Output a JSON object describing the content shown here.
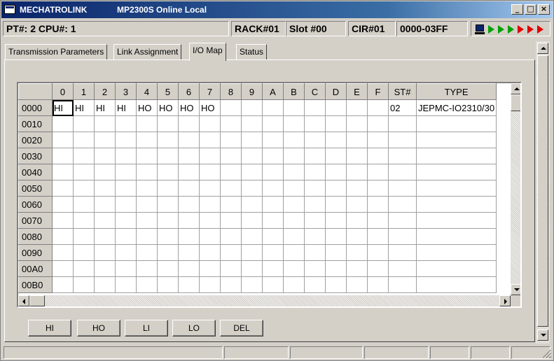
{
  "window": {
    "title_left": "MECHATROLINK",
    "title_right": "MP2300S  Online  Local",
    "controls": {
      "minimize": "_",
      "maximize": "□",
      "close": "×"
    }
  },
  "header": {
    "pt_cpu": "PT#: 2 CPU#: 1",
    "rack": "RACK#01",
    "slot": "Slot #00",
    "cir": "CIR#01",
    "range": "0000-03FF",
    "indicator": {
      "icon": "pc-icon",
      "arrows_green": 3,
      "arrows_red": 3,
      "green": "#00a000",
      "red": "#e00000"
    }
  },
  "tabs": [
    {
      "label": "Transmission Parameters",
      "active": false
    },
    {
      "label": "Link Assignment",
      "active": false
    },
    {
      "label": "I/O Map",
      "active": true
    },
    {
      "label": "Status",
      "active": false
    }
  ],
  "grid": {
    "columns": [
      "0",
      "1",
      "2",
      "3",
      "4",
      "5",
      "6",
      "7",
      "8",
      "9",
      "A",
      "B",
      "C",
      "D",
      "E",
      "F",
      "ST#",
      "TYPE"
    ],
    "rows": [
      {
        "addr": "0000",
        "cells": [
          "HI",
          "HI",
          "HI",
          "HI",
          "HO",
          "HO",
          "HO",
          "HO",
          "",
          "",
          "",
          "",
          "",
          "",
          "",
          "",
          "02",
          "JEPMC-IO2310/30"
        ]
      },
      {
        "addr": "0010",
        "cells": []
      },
      {
        "addr": "0020",
        "cells": []
      },
      {
        "addr": "0030",
        "cells": []
      },
      {
        "addr": "0040",
        "cells": []
      },
      {
        "addr": "0050",
        "cells": []
      },
      {
        "addr": "0060",
        "cells": []
      },
      {
        "addr": "0070",
        "cells": []
      },
      {
        "addr": "0080",
        "cells": []
      },
      {
        "addr": "0090",
        "cells": []
      },
      {
        "addr": "00A0",
        "cells": []
      },
      {
        "addr": "00B0",
        "cells": []
      }
    ]
  },
  "buttons": [
    "HI",
    "HO",
    "LI",
    "LO",
    "DEL"
  ]
}
